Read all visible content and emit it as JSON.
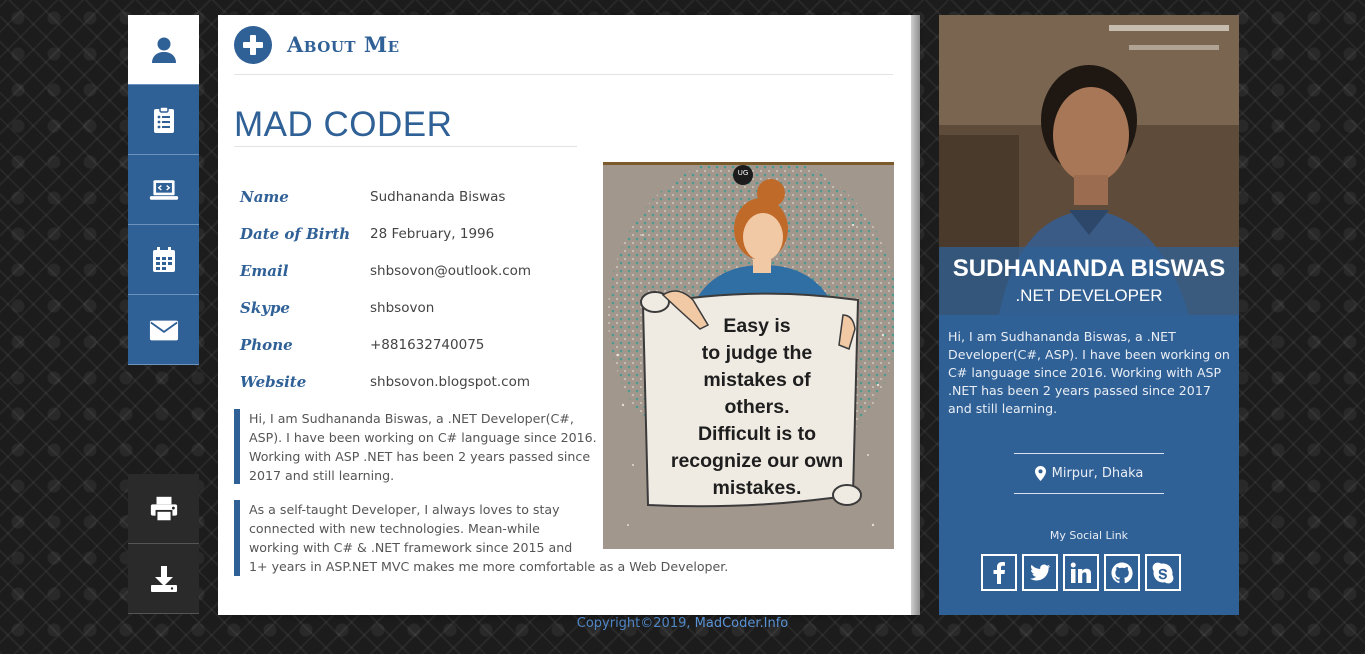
{
  "nav": {
    "items": [
      {
        "icon": "user-icon",
        "active": true
      },
      {
        "icon": "clipboard-list-icon",
        "active": false
      },
      {
        "icon": "laptop-code-icon",
        "active": false
      },
      {
        "icon": "calendar-icon",
        "active": false
      },
      {
        "icon": "envelope-icon",
        "active": false
      }
    ],
    "bottom_items": [
      {
        "icon": "print-icon"
      },
      {
        "icon": "download-icon"
      }
    ]
  },
  "main": {
    "section_title": "About Me",
    "name_title": "MAD CODER",
    "info": [
      {
        "key": "Name",
        "value": "Sudhananda Biswas"
      },
      {
        "key": "Date of Birth",
        "value": "28 February, 1996"
      },
      {
        "key": "Email",
        "value": "shbsovon@outlook.com"
      },
      {
        "key": "Skype",
        "value": "shbsovon"
      },
      {
        "key": "Phone",
        "value": "+881632740075"
      },
      {
        "key": "Website",
        "value": "shbsovon.blogspot.com"
      }
    ],
    "quote_1": "Hi, I am Sudhananda Biswas, a .NET Developer(C#, ASP). I have been working on C# language since 2016. Working with ASP .NET has been 2 years passed since 2017 and still learning.",
    "quote_2_lines": [
      "As a self-taught Developer, I always loves to stay",
      "connected with new technologies. Mean-while",
      "working with C# & .NET framework since 2015 and",
      "1+ years in ASP.NET MVC makes me more comfortable as a Web Developer."
    ],
    "meme": {
      "badge": "UG",
      "text_lines": [
        "Easy is",
        "to judge the",
        "mistakes of",
        "others.",
        "Difficult is to",
        "recognize our own",
        "mistakes."
      ]
    }
  },
  "card": {
    "name": "SUDHANANDA BISWAS",
    "role": ".NET DEVELOPER",
    "bio": "Hi, I am Sudhananda Biswas, a .NET Developer(C#, ASP). I have been working on C# language since 2016. Working with ASP .NET has been 2 years passed since 2017 and still learning.",
    "location": "Mirpur, Dhaka",
    "social_label": "My Social Link",
    "social": [
      "facebook-icon",
      "twitter-icon",
      "linkedin-icon",
      "github-icon",
      "skype-icon"
    ]
  },
  "footer": {
    "prefix": "Copyright©2019,",
    "link": "MadCoder.Info"
  },
  "colors": {
    "primary": "#2f6096",
    "dark": "#2a2a2a",
    "link": "#4f86c6"
  }
}
